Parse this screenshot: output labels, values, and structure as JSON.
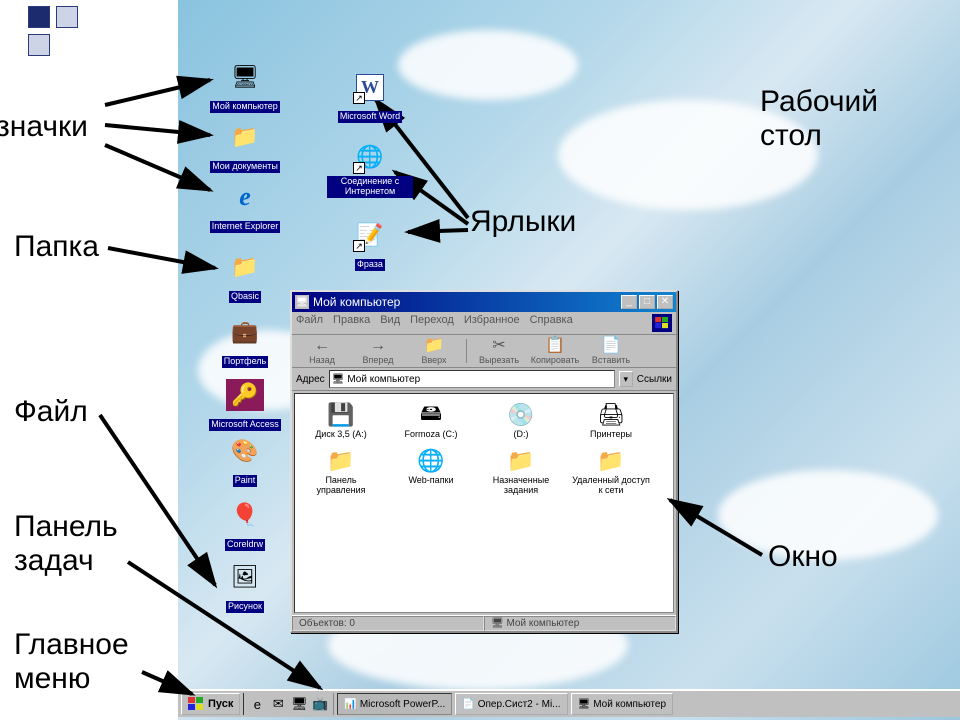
{
  "annotations": {
    "icons": "значки",
    "folder": "Папка",
    "file": "Файл",
    "taskbar": "Панель\nзадач",
    "main_menu": "Главное\nменю",
    "desktop": "Рабочий\nстол",
    "shortcuts": "Ярлыки",
    "window": "Окно"
  },
  "desktop_icons": {
    "col1": [
      {
        "label": "Мой компьютер",
        "id": "my-computer",
        "icon": "🖥"
      },
      {
        "label": "Мои документы",
        "id": "my-documents",
        "icon": "📁"
      },
      {
        "label": "Internet Explorer",
        "id": "ie",
        "icon": "e"
      },
      {
        "label": "Qbasic",
        "id": "qbasic",
        "icon": "📁"
      },
      {
        "label": "Портфель",
        "id": "briefcase",
        "icon": "💼"
      },
      {
        "label": "Microsoft Access",
        "id": "access",
        "icon": "🔑"
      },
      {
        "label": "Paint",
        "id": "paint",
        "icon": "🎨"
      },
      {
        "label": "Coreldrw",
        "id": "corel",
        "icon": "🎈"
      },
      {
        "label": "Рисунок",
        "id": "picture",
        "icon": "🖼"
      }
    ],
    "col2": [
      {
        "label": "Microsoft Word",
        "id": "word",
        "icon": "W",
        "shortcut": true
      },
      {
        "label": "Соединение с Интернетом",
        "id": "internet-conn",
        "icon": "🌐",
        "shortcut": true
      },
      {
        "label": "Фраза",
        "id": "phrase",
        "icon": "📝",
        "shortcut": true
      }
    ]
  },
  "window": {
    "title": "Мой компьютер",
    "menu": [
      "Файл",
      "Правка",
      "Вид",
      "Переход",
      "Избранное",
      "Справка"
    ],
    "toolbar": [
      {
        "label": "Назад",
        "icon": "←"
      },
      {
        "label": "Вперед",
        "icon": "→"
      },
      {
        "label": "Вверх",
        "icon": "📁"
      },
      {
        "label": "Вырезать",
        "icon": "✂"
      },
      {
        "label": "Копировать",
        "icon": "📋"
      },
      {
        "label": "Вставить",
        "icon": "📄"
      }
    ],
    "address_label": "Адрес",
    "address_value": "Мой компьютер",
    "links_label": "Ссылки",
    "items": [
      {
        "label": "Диск 3,5 (A:)",
        "icon": "💾"
      },
      {
        "label": "Formoza (C:)",
        "icon": "🖴"
      },
      {
        "label": "(D:)",
        "icon": "💿"
      },
      {
        "label": "Принтеры",
        "icon": "🖨"
      },
      {
        "label": "Панель управления",
        "icon": "📁"
      },
      {
        "label": "Web-папки",
        "icon": "🌐"
      },
      {
        "label": "Назначенные задания",
        "icon": "📁"
      },
      {
        "label": "Удаленный доступ к сети",
        "icon": "📁"
      }
    ],
    "status_left": "Объектов: 0",
    "status_right": "Мой компьютер"
  },
  "taskbar": {
    "start": "Пуск",
    "items": [
      {
        "label": "Microsoft PowerP...",
        "active": true
      },
      {
        "label": "Опер.Сист2 - Mi...",
        "active": false
      },
      {
        "label": "Мой компьютер",
        "active": false
      }
    ]
  }
}
